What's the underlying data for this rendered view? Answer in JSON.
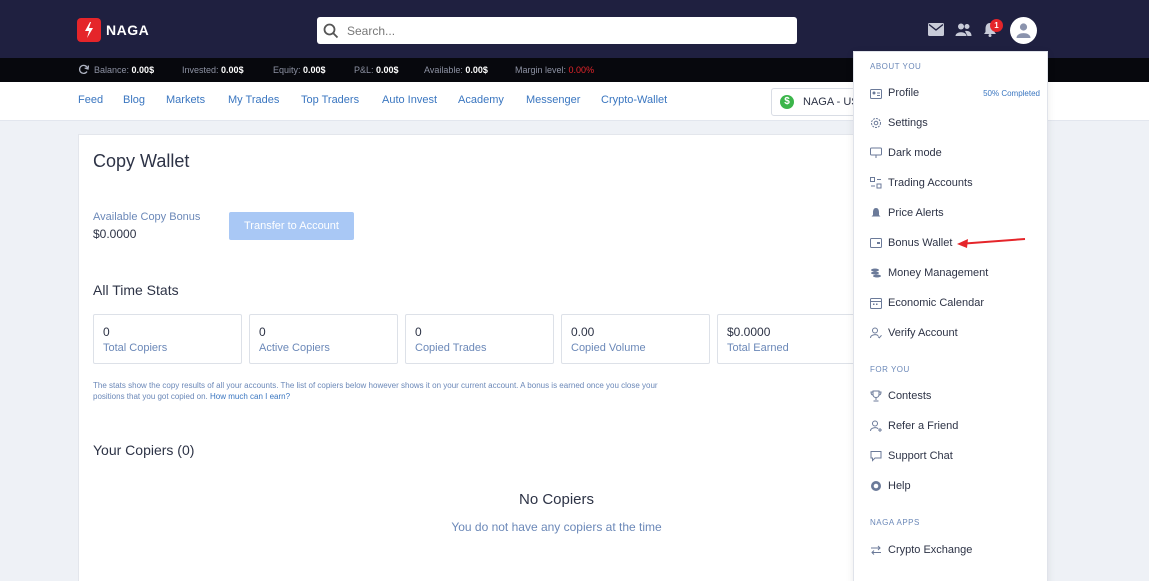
{
  "header": {
    "logo_text": "NAGA",
    "search_placeholder": "Search...",
    "notification_count": "1"
  },
  "stats_bar": {
    "balance_label": "Balance:",
    "balance_value": "0.00$",
    "invested_label": "Invested:",
    "invested_value": "0.00$",
    "equity_label": "Equity:",
    "equity_value": "0.00$",
    "pl_label": "P&L:",
    "pl_value": "0.00$",
    "available_label": "Available:",
    "available_value": "0.00$",
    "margin_label": "Margin level:",
    "margin_value": "0.00%"
  },
  "nav": {
    "items": [
      "Feed",
      "Blog",
      "Markets",
      "My Trades",
      "Top Traders",
      "Auto Invest",
      "Academy",
      "Messenger",
      "Crypto-Wallet"
    ],
    "account_label": "NAGA - US"
  },
  "main": {
    "title": "Copy Wallet",
    "bonus_label": "Available Copy Bonus",
    "bonus_value": "$0.0000",
    "transfer_button": "Transfer to Account",
    "stats_title": "All Time Stats",
    "stats": [
      {
        "value": "0",
        "label": "Total Copiers"
      },
      {
        "value": "0",
        "label": "Active Copiers"
      },
      {
        "value": "0",
        "label": "Copied Trades"
      },
      {
        "value": "0.00",
        "label": "Copied Volume"
      },
      {
        "value": "$0.0000",
        "label": "Total Earned"
      }
    ],
    "note_text": "The stats show the copy results of all your accounts. The list of copiers below however shows it on your current account. A bonus is earned once you close your positions that you got copied on.",
    "note_link": "How much can I earn?",
    "copiers_title": "Your Copiers (0)",
    "empty_title": "No Copiers",
    "empty_subtitle": "You do not have any copiers at the time"
  },
  "dropdown": {
    "section_about": "ABOUT YOU",
    "profile": "Profile",
    "profile_tag": "50% Completed",
    "settings": "Settings",
    "dark_mode": "Dark mode",
    "trading_accounts": "Trading Accounts",
    "price_alerts": "Price Alerts",
    "bonus_wallet": "Bonus Wallet",
    "money_management": "Money Management",
    "economic_calendar": "Economic Calendar",
    "verify_account": "Verify Account",
    "section_for_you": "FOR YOU",
    "contests": "Contests",
    "refer_friend": "Refer a Friend",
    "support_chat": "Support Chat",
    "help": "Help",
    "section_apps": "NAGA APPS",
    "crypto_exchange": "Crypto Exchange"
  },
  "colors": {
    "header_bg": "#1f2040",
    "brand_red": "#e5252a",
    "link_blue": "#3a76c0",
    "label_blue": "#6b88b8",
    "button_disabled": "#a9c8f5",
    "annotation_arrow": "#e5252a"
  }
}
